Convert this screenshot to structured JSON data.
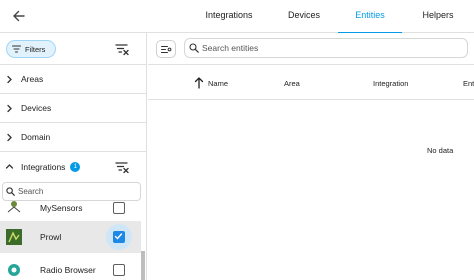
{
  "tabs": [
    {
      "label": "Integrations"
    },
    {
      "label": "Devices"
    },
    {
      "label": "Entities"
    },
    {
      "label": "Helpers"
    }
  ],
  "active_tab": "Entities",
  "accent_color": "#039be5",
  "sidebar": {
    "filters_label": "Filters",
    "sections": [
      {
        "label": "Areas",
        "state": "collapsed"
      },
      {
        "label": "Devices",
        "state": "collapsed"
      },
      {
        "label": "Domain",
        "state": "collapsed"
      }
    ],
    "integrations": {
      "label": "Integrations",
      "badge": "1",
      "state": "expanded",
      "search_placeholder": "Search",
      "items": [
        {
          "name": "MySensors",
          "checked": false
        },
        {
          "name": "Prowl",
          "checked": true
        },
        {
          "name": "Radio Browser",
          "checked": false
        }
      ]
    }
  },
  "main": {
    "search_placeholder": "Search entities",
    "columns": [
      "Name",
      "Area",
      "Integration",
      "Ent"
    ],
    "sort_icon": "arrow-up-icon",
    "empty_text": "No data"
  }
}
